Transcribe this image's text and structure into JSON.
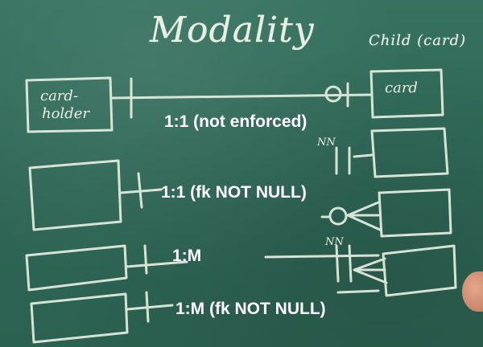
{
  "board": {
    "title": "Modality",
    "child_label": "Child (card)",
    "parent_box_label_line1": "card-",
    "parent_box_label_line2": "holder",
    "child_box_label": "card"
  },
  "captions": [
    "1:1 (not enforced)",
    "1:1 (fk NOT NULL)",
    "1:M",
    "1:M (fk NOT NULL)"
  ],
  "nn_marks": [
    "NN",
    "NN"
  ]
}
